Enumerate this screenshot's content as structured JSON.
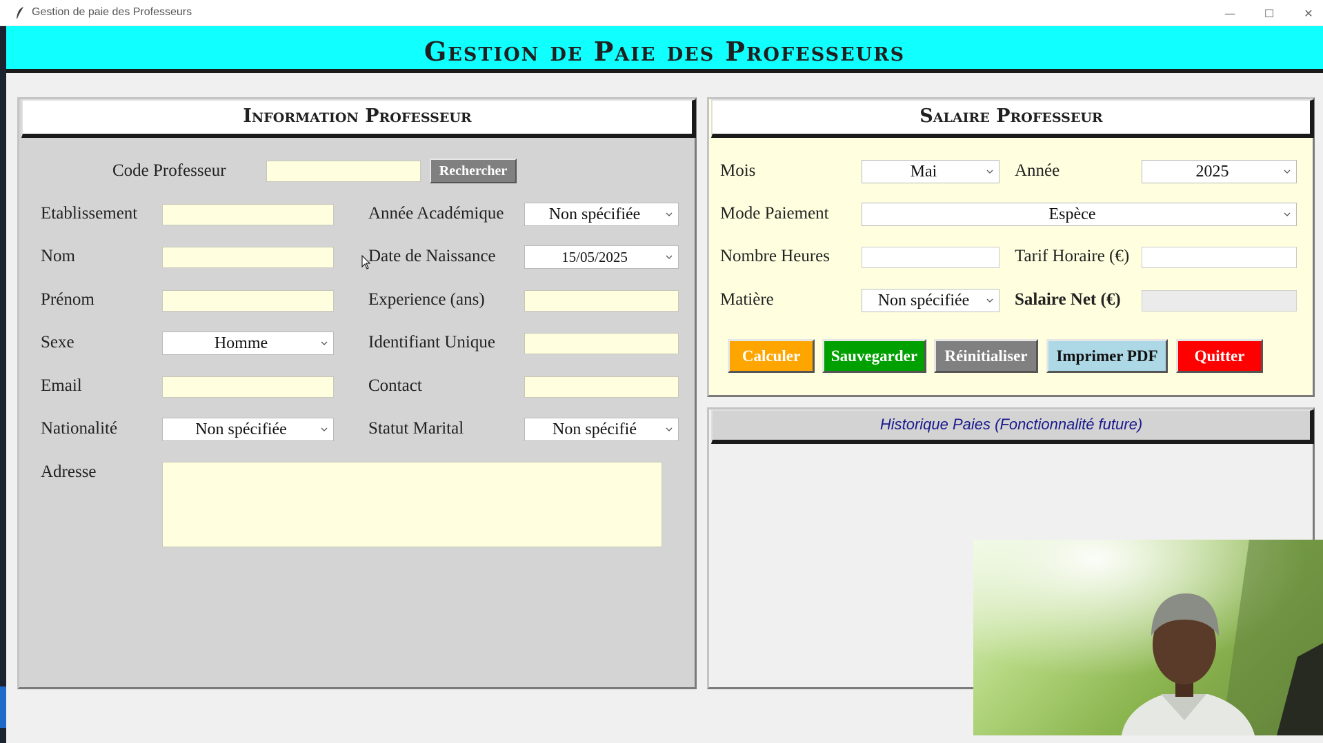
{
  "window": {
    "title": "Gestion de paie des Professeurs",
    "controls": {
      "minimize": "—",
      "maximize": "☐",
      "close": "✕"
    }
  },
  "app": {
    "banner_title": "Gestion de Paie des Professeurs"
  },
  "info_panel": {
    "title": "Information Professeur",
    "code_label": "Code Professeur",
    "code_value": "",
    "search_button": "Rechercher",
    "fields": {
      "etablissement": {
        "label": "Etablissement",
        "value": ""
      },
      "annee_academique": {
        "label": "Année Académique",
        "value": "Non spécifiée"
      },
      "nom": {
        "label": "Nom",
        "value": ""
      },
      "date_naissance": {
        "label": "Date de Naissance",
        "value": "15/05/2025"
      },
      "prenom": {
        "label": "Prénom",
        "value": ""
      },
      "experience": {
        "label": "Experience (ans)",
        "value": ""
      },
      "sexe": {
        "label": "Sexe",
        "value": "Homme"
      },
      "identifiant": {
        "label": "Identifiant Unique",
        "value": ""
      },
      "email": {
        "label": "Email",
        "value": ""
      },
      "contact": {
        "label": "Contact",
        "value": ""
      },
      "nationalite": {
        "label": "Nationalité",
        "value": "Non spécifiée"
      },
      "statut_marital": {
        "label": "Statut Marital",
        "value": "Non spécifié"
      },
      "adresse": {
        "label": "Adresse",
        "value": ""
      }
    }
  },
  "salary_panel": {
    "title": "Salaire Professeur",
    "mois": {
      "label": "Mois",
      "value": "Mai"
    },
    "annee": {
      "label": "Année",
      "value": "2025"
    },
    "mode_paiement": {
      "label": "Mode Paiement",
      "value": "Espèce"
    },
    "nombre_heures": {
      "label": "Nombre Heures",
      "value": ""
    },
    "tarif_horaire": {
      "label": "Tarif Horaire (€)",
      "value": ""
    },
    "matiere": {
      "label": "Matière",
      "value": "Non spécifiée"
    },
    "salaire_net": {
      "label": "Salaire Net (€)",
      "value": ""
    },
    "buttons": {
      "calculer": "Calculer",
      "sauvegarder": "Sauvegarder",
      "reinitialiser": "Réinitialiser",
      "imprimer": "Imprimer PDF",
      "quitter": "Quitter"
    },
    "colors": {
      "calculer": "#ffa500",
      "sauvegarder": "#00a000",
      "reinitialiser": "#808080",
      "imprimer": "#add8e6",
      "quitter": "#ff0000",
      "panel_bg": "#ffffe0",
      "banner": "#10ffff"
    }
  },
  "history_panel": {
    "title": "Historique Paies (Fonctionnalité future)"
  }
}
